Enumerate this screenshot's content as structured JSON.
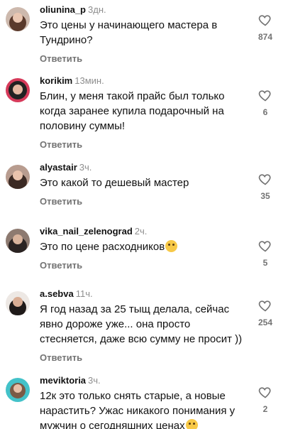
{
  "comments": [
    {
      "username": "oliunina_p",
      "time": "3дн.",
      "text": "Это цены у начинающего мастера в\nТундрино?",
      "reply": "Ответить",
      "likes": "874",
      "emoji": false
    },
    {
      "username": "korikim",
      "time": "13мин.",
      "text": "Блин, у меня такой прайс был только\nкогда заранее купила подарочный на\nполовину суммы!",
      "reply": "Ответить",
      "likes": "6",
      "emoji": false
    },
    {
      "username": "alyastair",
      "time": "3ч.",
      "text": "Это какой то дешевый мастер",
      "reply": "Ответить",
      "likes": "35",
      "emoji": false
    },
    {
      "username": "vika_nail_zelenograd",
      "time": "2ч.",
      "text": "Это по цене расходников",
      "reply": "Ответить",
      "likes": "5",
      "emoji": true,
      "emoji_name": "crying-face"
    },
    {
      "username": "a.sebva",
      "time": "11ч.",
      "text": "Я год назад за 25 тыщ делала, сейчас\nявно дороже уже... она просто\nстесняется, даже всю сумму не просит ))",
      "reply": "Ответить",
      "likes": "254",
      "emoji": false
    },
    {
      "username": "meviktoria",
      "time": "3ч.",
      "text": "12к это только снять старые, а новые\nнарастить? Ужас никакого понимания у\nмужчин о сегодняшних ценах",
      "reply": "",
      "likes": "2",
      "emoji": true,
      "emoji_name": "eye-roll-face"
    }
  ],
  "icons": {
    "like": "heart-outline-icon"
  },
  "colors": {
    "muted": "#737373",
    "time": "#8e8e8e",
    "text": "#111111",
    "background": "#ffffff"
  }
}
